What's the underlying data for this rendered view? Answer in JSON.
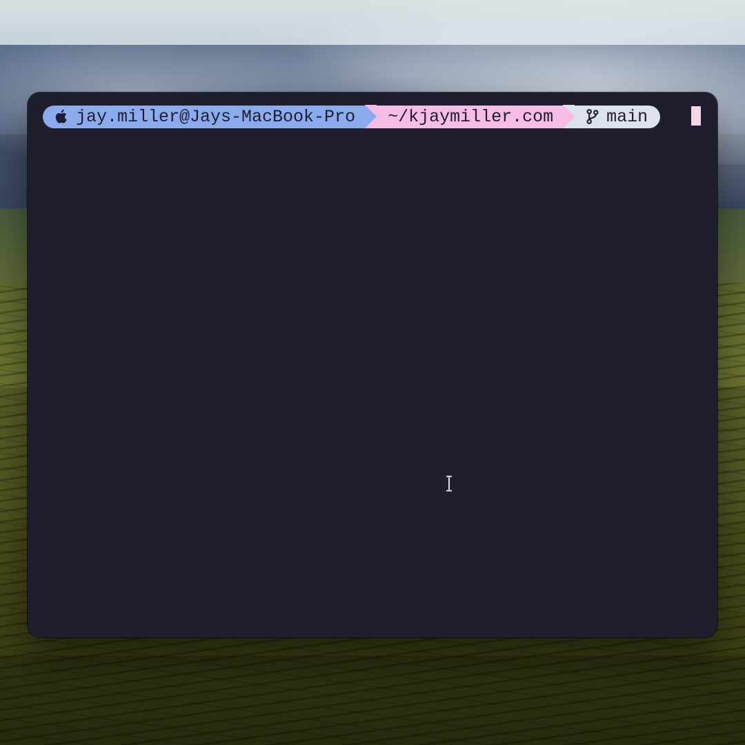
{
  "prompt": {
    "user_host": "jay.miller@Jays-MacBook-Pro",
    "path": "~/kjaymiller.com",
    "branch": "main"
  },
  "colors": {
    "terminal_bg": "#1f1e2e",
    "seg_host_bg": "#8caaee",
    "seg_path_bg": "#f5bde6",
    "seg_branch_bg": "#dde3ec",
    "seg_fg": "#1f1e2e",
    "cursor": "#f5d5df"
  },
  "icons": {
    "apple": "apple-icon",
    "git_branch": "git-branch-icon"
  }
}
